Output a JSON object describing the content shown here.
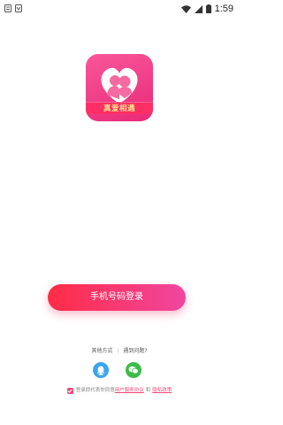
{
  "status_bar": {
    "time": "1:59"
  },
  "logo": {
    "ribbon_text": "真爱相遇"
  },
  "main": {
    "phone_login_label": "手机号码登录"
  },
  "links": {
    "other_methods": "其他方式",
    "separator": "|",
    "problem": "遇到问题?"
  },
  "social": [
    {
      "name": "qq",
      "icon": "qq-icon",
      "color": "#3da5ee"
    },
    {
      "name": "wechat",
      "icon": "wechat-icon",
      "color": "#3dbb4b"
    }
  ],
  "agreement": {
    "checked": true,
    "prefix": "登录即代表你同意",
    "user_agreement": "用户服务协议",
    "and": "和",
    "privacy_policy": "隐私政策"
  },
  "colors": {
    "accent_pink": "#f0487a",
    "button_gradient_start": "#ff2c45",
    "button_gradient_end": "#f046a0",
    "qq_blue": "#3da5ee",
    "wechat_green": "#3dbb4b"
  }
}
